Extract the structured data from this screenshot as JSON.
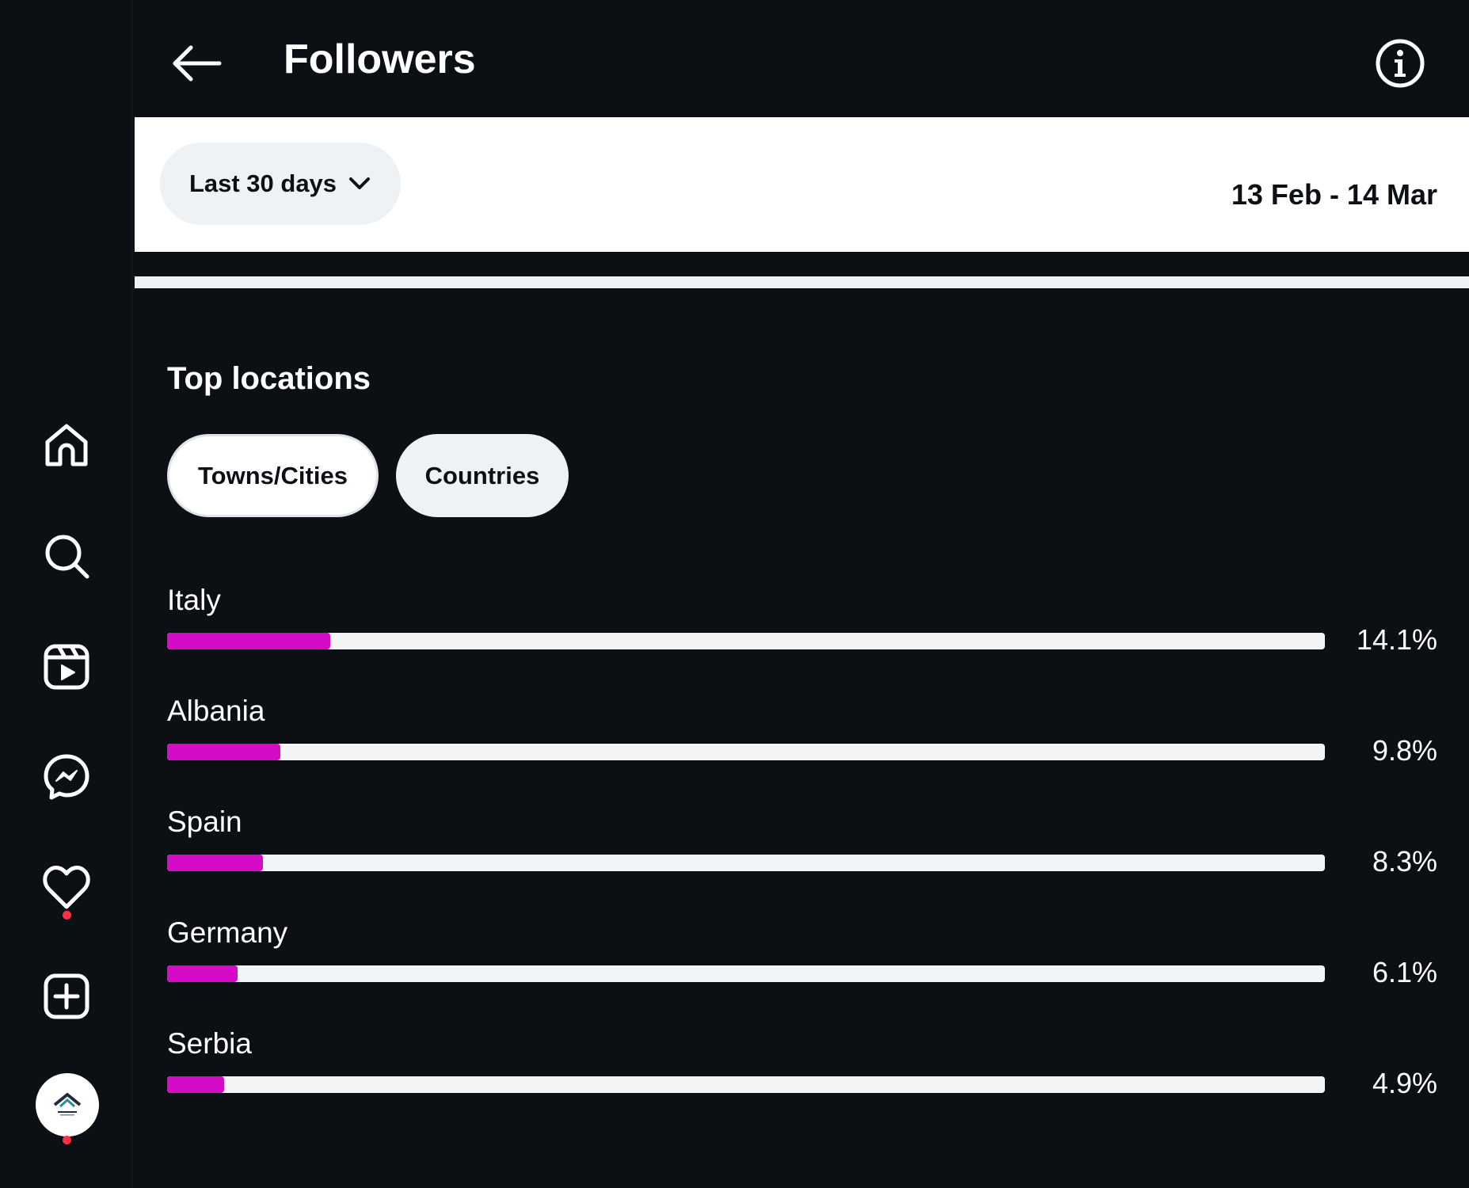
{
  "header": {
    "title": "Followers"
  },
  "filter": {
    "range_label": "Last 30 days",
    "date_range": "13 Feb - 14 Mar"
  },
  "section": {
    "title": "Top locations",
    "tabs": [
      {
        "label": "Towns/Cities"
      },
      {
        "label": "Countries"
      }
    ]
  },
  "locations": [
    {
      "name": "Italy",
      "percent_label": "14.1%",
      "fill_fraction": 0.141
    },
    {
      "name": "Albania",
      "percent_label": "9.8%",
      "fill_fraction": 0.098
    },
    {
      "name": "Spain",
      "percent_label": "8.3%",
      "fill_fraction": 0.083
    },
    {
      "name": "Germany",
      "percent_label": "6.1%",
      "fill_fraction": 0.061
    },
    {
      "name": "Serbia",
      "percent_label": "4.9%",
      "fill_fraction": 0.049
    }
  ],
  "nav": {
    "items": [
      {
        "icon": "home-icon"
      },
      {
        "icon": "search-icon"
      },
      {
        "icon": "reels-icon"
      },
      {
        "icon": "messenger-icon"
      },
      {
        "icon": "heart-icon"
      },
      {
        "icon": "create-icon"
      },
      {
        "icon": "profile-avatar"
      }
    ]
  },
  "colors": {
    "background": "#0c0f14",
    "bar_fill": "#d40cc8",
    "bar_track": "#f3f4f6",
    "notification": "#ff3040"
  }
}
